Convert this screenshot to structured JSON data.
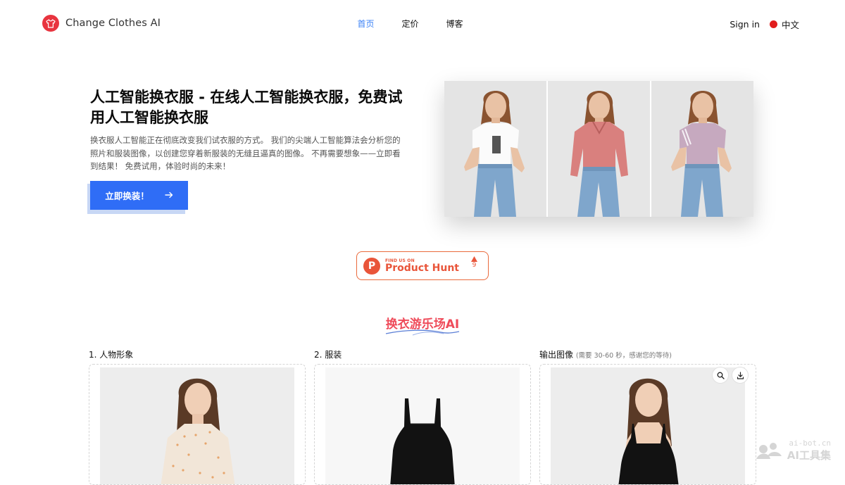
{
  "brand": {
    "name": "Change Clothes AI",
    "logo_icon": "tshirt-icon",
    "accent": "#e8343f"
  },
  "nav": {
    "links": [
      {
        "label": "首页",
        "active": true
      },
      {
        "label": "定价",
        "active": false
      },
      {
        "label": "博客",
        "active": false
      }
    ],
    "sign_in": "Sign in",
    "language": "中文"
  },
  "hero": {
    "title": "人工智能换衣服 - 在线人工智能换衣服，免费试用人工智能换衣服",
    "description": "换衣服人工智能正在彻底改变我们试衣服的方式。 我们的尖端人工智能算法会分析您的照片和服装图像，以创建您穿着新服装的无缝且逼真的图像。 不再需要想象——立即看到结果！ 免费试用，体验时尚的未来！",
    "cta_label": "立即换装！",
    "cta_color": "#2f6df6"
  },
  "product_hunt": {
    "small_text": "FIND US ON",
    "name": "Product Hunt",
    "votes": "9"
  },
  "playground": {
    "title": "换衣游乐场AI",
    "columns": [
      {
        "label": "1. 人物形象",
        "note": ""
      },
      {
        "label": "2. 服装",
        "note": ""
      },
      {
        "label": "输出图像",
        "note": "(需要 30-60 秒，感谢您的等待)"
      }
    ]
  },
  "watermark": {
    "line1": "ai-bot.cn",
    "line2": "AI工具集"
  }
}
